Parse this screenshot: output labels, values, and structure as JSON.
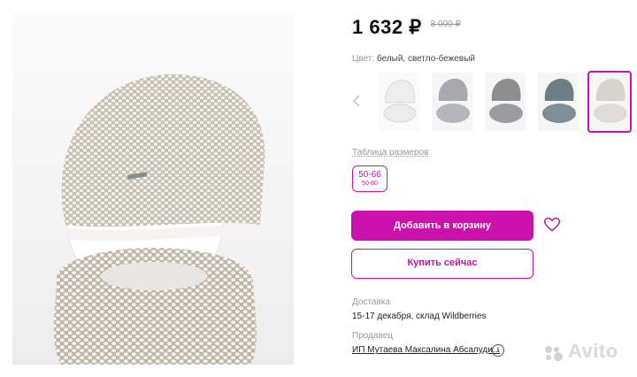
{
  "product": {
    "price": "1 632 ₽",
    "old_price": "8 000 ₽",
    "color_label": "Цвет:",
    "color_value": "белый, светло-бежевый"
  },
  "thumbnails": [
    {
      "name": "white",
      "color": "#eeeeee"
    },
    {
      "name": "grey",
      "color": "#a6a9ad"
    },
    {
      "name": "dark-grey",
      "color": "#8c8f92"
    },
    {
      "name": "teal-grey",
      "color": "#6d7f84"
    },
    {
      "name": "beige",
      "color": "#d9d4cb",
      "selected": true
    }
  ],
  "sizes": {
    "table_label": "Таблица размеров",
    "selected_main": "50-66",
    "selected_sub": "50-60"
  },
  "actions": {
    "add_to_cart": "Добавить в корзину",
    "buy_now": "Купить сейчас"
  },
  "delivery": {
    "label": "Доставка",
    "value": "15-17 декабря, склад Wildberries"
  },
  "seller": {
    "label": "Продавец",
    "value": "ИП Мутаева Максалина Абсалуди..."
  },
  "watermark": "Avito",
  "colors": {
    "accent": "#cb11ab",
    "muted_text": "#999999"
  },
  "icons": [
    "arrow-left-icon",
    "heart-icon",
    "info-icon"
  ]
}
